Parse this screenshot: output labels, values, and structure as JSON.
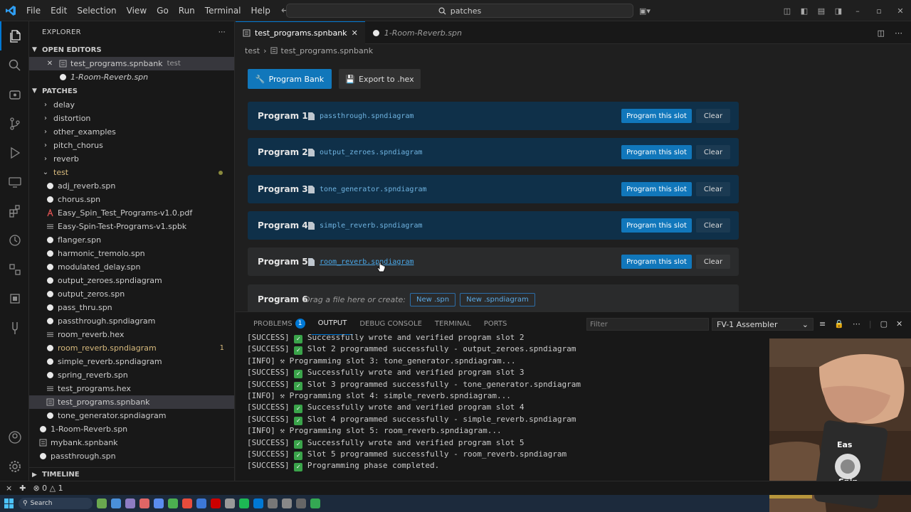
{
  "titlebar": {
    "menu": [
      "File",
      "Edit",
      "Selection",
      "View",
      "Go",
      "Run",
      "Terminal",
      "Help"
    ],
    "search": "patches"
  },
  "explorer": {
    "title": "EXPLORER",
    "open_editors_label": "OPEN EDITORS",
    "open_editors": [
      {
        "name": "test_programs.spnbank",
        "desc": "test"
      },
      {
        "name": "1-Room-Reverb.spn",
        "desc": ""
      }
    ],
    "patches_label": "PATCHES",
    "folders": [
      "delay",
      "distortion",
      "other_examples",
      "pitch_chorus",
      "reverb"
    ],
    "test_folder": "test",
    "test_files": [
      {
        "name": "adj_reverb.spn",
        "icon": "spn"
      },
      {
        "name": "chorus.spn",
        "icon": "spn"
      },
      {
        "name": "Easy_Spin_Test_Programs-v1.0.pdf",
        "icon": "pdf"
      },
      {
        "name": "Easy-Spin-Test-Programs-v1.spbk",
        "icon": "lines"
      },
      {
        "name": "flanger.spn",
        "icon": "spn"
      },
      {
        "name": "harmonic_tremolo.spn",
        "icon": "spn"
      },
      {
        "name": "modulated_delay.spn",
        "icon": "spn"
      },
      {
        "name": "output_zeroes.spndiagram",
        "icon": "spn"
      },
      {
        "name": "output_zeros.spn",
        "icon": "spn"
      },
      {
        "name": "pass_thru.spn",
        "icon": "spn"
      },
      {
        "name": "passthrough.spndiagram",
        "icon": "spn"
      },
      {
        "name": "room_reverb.hex",
        "icon": "lines"
      },
      {
        "name": "room_reverb.spndiagram",
        "icon": "spn",
        "badge": "1",
        "warn": true
      },
      {
        "name": "simple_reverb.spndiagram",
        "icon": "spn"
      },
      {
        "name": "spring_reverb.spn",
        "icon": "spn"
      },
      {
        "name": "test_programs.hex",
        "icon": "lines"
      },
      {
        "name": "test_programs.spnbank",
        "icon": "bank",
        "selected": true
      },
      {
        "name": "tone_generator.spndiagram",
        "icon": "spn"
      }
    ],
    "root_files": [
      {
        "name": "1-Room-Reverb.spn",
        "icon": "spn"
      },
      {
        "name": "mybank.spnbank",
        "icon": "bank"
      },
      {
        "name": "passthrough.spn",
        "icon": "spn"
      }
    ],
    "timeline_label": "TIMELINE"
  },
  "tabs": [
    {
      "label": "test_programs.spnbank",
      "active": true
    },
    {
      "label": "1-Room-Reverb.spn",
      "active": false
    }
  ],
  "breadcrumb": {
    "folder": "test",
    "file": "test_programs.spnbank"
  },
  "editor": {
    "program_bank_label": "Program Bank",
    "export_label": "Export to .hex",
    "slots": [
      {
        "label": "Program 1",
        "file": "passthrough.spndiagram",
        "program": "Program this slot",
        "clear": "Clear"
      },
      {
        "label": "Program 2",
        "file": "output_zeroes.spndiagram",
        "program": "Program this slot",
        "clear": "Clear"
      },
      {
        "label": "Program 3",
        "file": "tone_generator.spndiagram",
        "program": "Program this slot",
        "clear": "Clear"
      },
      {
        "label": "Program 4",
        "file": "simple_reverb.spndiagram",
        "program": "Program this slot",
        "clear": "Clear"
      },
      {
        "label": "Program 5",
        "file": "room_reverb.spndiagram",
        "program": "Program this slot",
        "clear": "Clear"
      }
    ],
    "slot6": {
      "label": "Program 6",
      "drag_text": "Drag a file here or create:",
      "new_spn": "New .spn",
      "new_diagram": "New .spndiagram"
    }
  },
  "panel": {
    "tabs": [
      "PROBLEMS",
      "OUTPUT",
      "DEBUG CONSOLE",
      "TERMINAL",
      "PORTS"
    ],
    "problems_count": "1",
    "filter_placeholder": "Filter",
    "channel": "FV-1 Assembler",
    "log": [
      {
        "tag": "[SUCCESS]",
        "icon": "check",
        "text": "Successfully wrote and verified program slot 2"
      },
      {
        "tag": "[SUCCESS]",
        "icon": "check",
        "text": "Slot 2 programmed successfully - output_zeroes.spndiagram"
      },
      {
        "tag": "[INFO]",
        "icon": "wrench",
        "text": "Programming slot 3: tone_generator.spndiagram..."
      },
      {
        "tag": "[SUCCESS]",
        "icon": "check",
        "text": "Successfully wrote and verified program slot 3"
      },
      {
        "tag": "[SUCCESS]",
        "icon": "check",
        "text": "Slot 3 programmed successfully - tone_generator.spndiagram"
      },
      {
        "tag": "[INFO]",
        "icon": "wrench",
        "text": "Programming slot 4: simple_reverb.spndiagram..."
      },
      {
        "tag": "[SUCCESS]",
        "icon": "check",
        "text": "Successfully wrote and verified program slot 4"
      },
      {
        "tag": "[SUCCESS]",
        "icon": "check",
        "text": "Slot 4 programmed successfully - simple_reverb.spndiagram"
      },
      {
        "tag": "[INFO]",
        "icon": "wrench",
        "text": "Programming slot 5: room_reverb.spndiagram..."
      },
      {
        "tag": "[SUCCESS]",
        "icon": "check",
        "text": "Successfully wrote and verified program slot 5"
      },
      {
        "tag": "[SUCCESS]",
        "icon": "check",
        "text": "Slot 5 programmed successfully - room_reverb.spndiagram"
      },
      {
        "tag": "[SUCCESS]",
        "icon": "check",
        "text": "Programming phase completed."
      }
    ]
  },
  "statusbar": {
    "errors": "0",
    "warnings": "1"
  },
  "taskbar": {
    "search": "Search"
  },
  "webcam": {
    "pedal_text_1": "Eas",
    "pedal_text_2": "Spin"
  },
  "colors": {
    "accent": "#0078d4",
    "button": "#1177bb",
    "slot_bg": "#0f3049",
    "link": "#6fb3e0",
    "warn": "#d7ba7d",
    "pdf": "#e05252",
    "success": "#3aa44a"
  }
}
